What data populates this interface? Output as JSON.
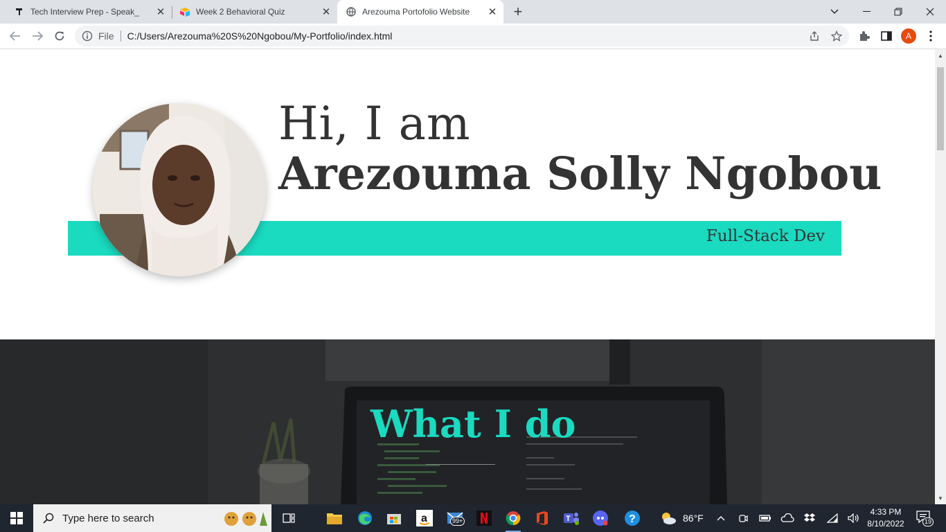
{
  "browser": {
    "tabs": [
      {
        "title": "Tech Interview Prep - Speak_",
        "icon": "hammer-icon",
        "active": false
      },
      {
        "title": "Week 2 Behavioral Quiz",
        "icon": "airtable-icon",
        "active": false
      },
      {
        "title": "Arezouma Portofolio Website",
        "icon": "globe-icon",
        "active": true
      }
    ],
    "address": {
      "scheme_label": "File",
      "url": "C:/Users/Arezouma%20S%20Ngobou/My-Portfolio/index.html"
    },
    "profile_initial": "A"
  },
  "page": {
    "greeting": "Hi, I am",
    "name": "Arezouma Solly Ngobou",
    "role": "Full-Stack Dev",
    "section_title": "What I do",
    "accent_color": "#1adac0"
  },
  "taskbar": {
    "search_placeholder": "Type here to search",
    "mail_badge": "99+",
    "weather_temp": "86°F",
    "time": "4:33 PM",
    "date": "8/10/2022",
    "notification_count": "19"
  }
}
